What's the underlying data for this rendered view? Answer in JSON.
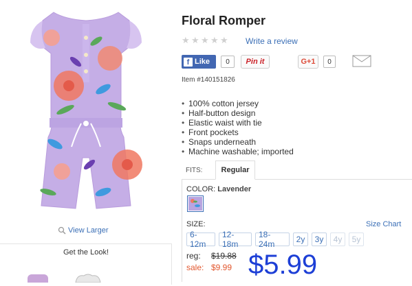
{
  "product": {
    "title": "Floral Romper",
    "item_number": "Item #140151826",
    "image_alt": "Lavender floral romper",
    "view_larger": "View Larger",
    "features": [
      "100% cotton jersey",
      "Half-button design",
      "Elastic waist with tie",
      "Front pockets",
      "Snaps underneath",
      "Machine washable; imported"
    ]
  },
  "reviews": {
    "rating": 0,
    "max_rating": 5,
    "write_review": "Write a review"
  },
  "social": {
    "fb_label": "Like",
    "fb_count": "0",
    "pinit_label": "Pin it",
    "gplus_label": "G+1",
    "gplus_count": "0"
  },
  "fits": {
    "label": "FITS:",
    "tabs": [
      "Regular"
    ],
    "selected": "Regular"
  },
  "color": {
    "label": "COLOR:",
    "selected": "Lavender",
    "swatch_color": "#b9a5e0"
  },
  "size": {
    "label": "SIZE:",
    "chart_link": "Size Chart",
    "options": [
      {
        "label": "6-12m",
        "available": true
      },
      {
        "label": "12-18m",
        "available": true
      },
      {
        "label": "18-24m",
        "available": true
      },
      {
        "label": "2y",
        "available": true
      },
      {
        "label": "3y",
        "available": true
      },
      {
        "label": "4y",
        "available": false
      },
      {
        "label": "5y",
        "available": false
      }
    ]
  },
  "price": {
    "reg_label": "reg:",
    "reg_value": "$19.88",
    "sale_label": "sale:",
    "sale_value": "$9.99",
    "current": "$5.99"
  },
  "get_the_look": {
    "title": "Get the Look!"
  },
  "colors": {
    "link": "#3b6fb6",
    "sale": "#e2572e",
    "price_big": "#1d3fd6",
    "fb": "#4267b2"
  }
}
